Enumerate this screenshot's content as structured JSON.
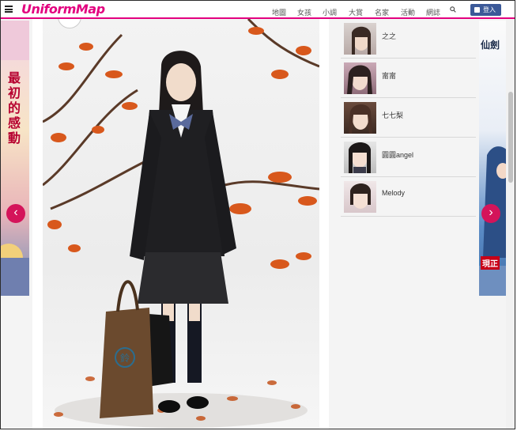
{
  "header": {
    "logo": "UniformMap",
    "nav": [
      "地圖",
      "女孩",
      "小調",
      "大賞",
      "名家",
      "活動",
      "網誌"
    ],
    "login_label": "登入"
  },
  "ads": {
    "left_text": "最初的感動",
    "right_title": "仙劍",
    "right_cta": "現正"
  },
  "sidebar_list": {
    "items": [
      {
        "name": "之之"
      },
      {
        "name": "甯甯"
      },
      {
        "name": "七七梨"
      },
      {
        "name": "圓圓angel"
      },
      {
        "name": "Melody"
      }
    ]
  },
  "photo": {
    "bag_mark": "鈴"
  },
  "colors": {
    "brand": "#e3007f",
    "accent": "#d4145a",
    "facebook": "#3b5998"
  },
  "icons": {
    "menu": "hamburger-icon",
    "search": "search-icon",
    "prev": "chevron-left-icon",
    "next": "chevron-right-icon"
  }
}
